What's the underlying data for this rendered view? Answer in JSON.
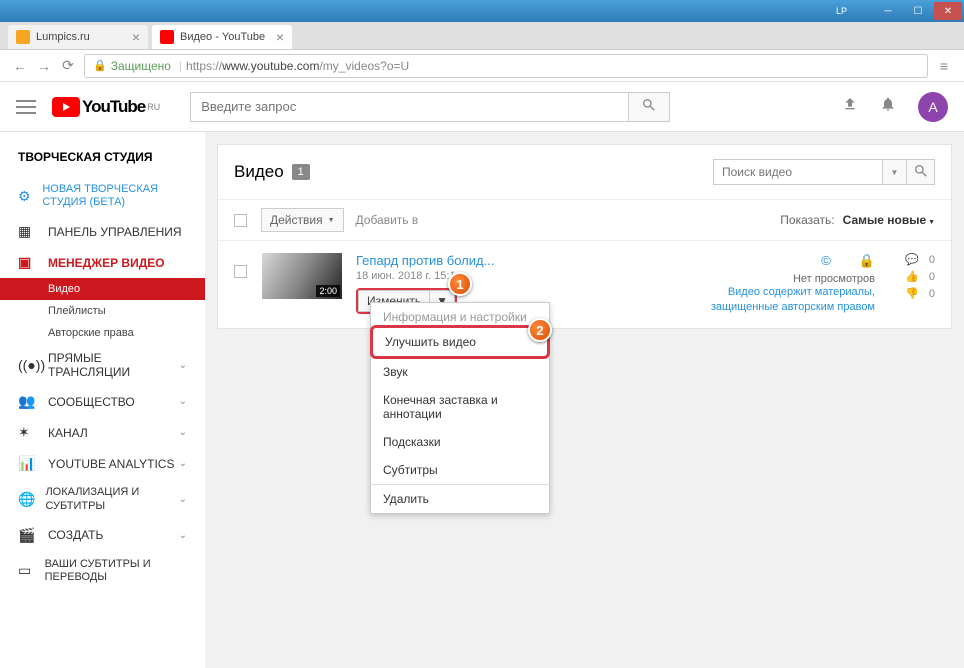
{
  "window": {
    "lp": "LP"
  },
  "tabs": [
    {
      "title": "Lumpics.ru"
    },
    {
      "title": "Видео - YouTube"
    }
  ],
  "address": {
    "secure": "Защищено",
    "protocol": "https://",
    "domain": "www.youtube.com",
    "path": "/my_videos?o=U"
  },
  "header": {
    "logo": "YouTube",
    "region": "RU",
    "search_placeholder": "Введите запрос",
    "avatar_letter": "A"
  },
  "sidebar": {
    "title": "ТВОРЧЕСКАЯ СТУДИЯ",
    "new_studio": "НОВАЯ ТВОРЧЕСКАЯ СТУДИЯ (БЕТА)",
    "dashboard": "ПАНЕЛЬ УПРАВЛЕНИЯ",
    "video_manager": "МЕНЕДЖЕР ВИДЕО",
    "sub_videos": "Видео",
    "sub_playlists": "Плейлисты",
    "sub_copyright": "Авторские права",
    "live": "ПРЯМЫЕ ТРАНСЛЯЦИИ",
    "community": "СООБЩЕСТВО",
    "channel": "КАНАЛ",
    "analytics": "YOUTUBE ANALYTICS",
    "localization": "ЛОКАЛИЗАЦИЯ И СУБТИТРЫ",
    "create": "СОЗДАТЬ",
    "your_subs": "ВАШИ СУБТИТРЫ И ПЕРЕВОДЫ"
  },
  "content": {
    "title": "Видео",
    "count": "1",
    "search_placeholder": "Поиск видео",
    "actions": "Действия",
    "add_to": "Добавить в",
    "show_label": "Показать:",
    "sort": "Самые новые"
  },
  "video": {
    "title": "Гепард против болид...",
    "date": "18 июн. 2018 г. 15:1...",
    "duration": "2:00",
    "edit": "Изменить",
    "no_views": "Нет просмотров",
    "warning": "Видео содержит материалы, защищенные авторским правом",
    "comments": "0",
    "likes": "0",
    "dislikes": "0"
  },
  "dropdown": {
    "info": "Информация и настройки",
    "enhance": "Улучшить видео",
    "audio": "Звук",
    "endscreen": "Конечная заставка и аннотации",
    "cards": "Подсказки",
    "subtitles": "Субтитры",
    "delete": "Удалить"
  },
  "markers": {
    "m1": "1",
    "m2": "2"
  }
}
